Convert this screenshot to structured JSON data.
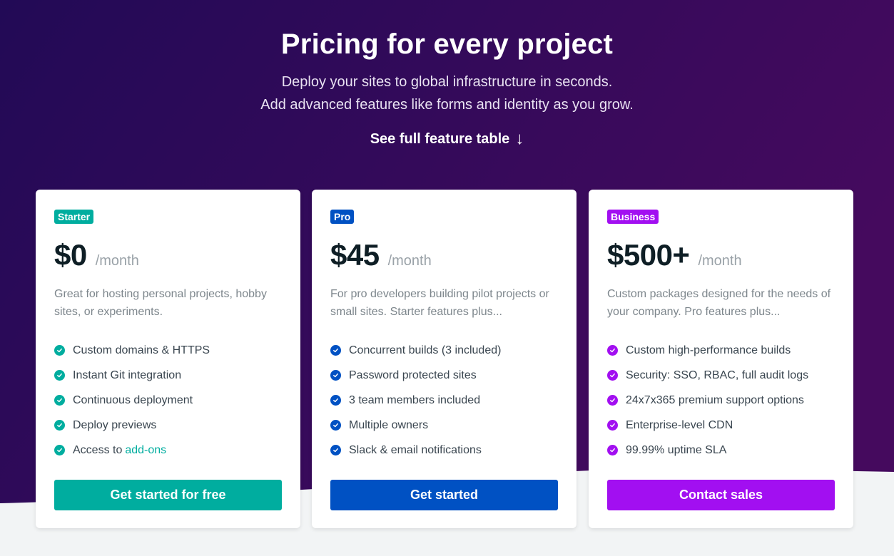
{
  "hero": {
    "title": "Pricing for every project",
    "subtitle_line1": "Deploy your sites to global infrastructure in seconds.",
    "subtitle_line2": "Add advanced features like forms and identity as you grow.",
    "feature_link": "See full feature table",
    "feature_link_arrow": "↓"
  },
  "colors": {
    "hero_gradient_start": "#220a56",
    "hero_gradient_end": "#450a5e",
    "page_background": "#f2f4f5",
    "starter_accent": "#00ad9f",
    "pro_accent": "#0051c3",
    "business_accent": "#a20ff1"
  },
  "plans": [
    {
      "badge": "Starter",
      "price": "$0",
      "period": "/month",
      "description": "Great for hosting personal projects, hobby sites, or experiments.",
      "features": [
        "Custom domains & HTTPS",
        "Instant Git integration",
        "Continuous deployment",
        "Deploy previews",
        "Access to"
      ],
      "features_link": "add-ons",
      "cta": "Get started for free",
      "icon": "check-circle-icon"
    },
    {
      "badge": "Pro",
      "price": "$45",
      "period": "/month",
      "description": "For pro developers building pilot projects or small sites. Starter features plus...",
      "features": [
        "Concurrent builds (3 included)",
        "Password protected sites",
        "3 team members included",
        "Multiple owners",
        "Slack & email notifications"
      ],
      "cta": "Get started",
      "icon": "check-circle-icon"
    },
    {
      "badge": "Business",
      "price": "$500+",
      "period": "/month",
      "description": "Custom packages designed for the needs of your company. Pro features plus...",
      "features": [
        "Custom high-performance builds",
        "Security: SSO, RBAC, full audit logs",
        "24x7x365 premium support options",
        "Enterprise-level CDN",
        "99.99% uptime SLA"
      ],
      "cta": "Contact sales",
      "icon": "check-circle-icon"
    }
  ]
}
